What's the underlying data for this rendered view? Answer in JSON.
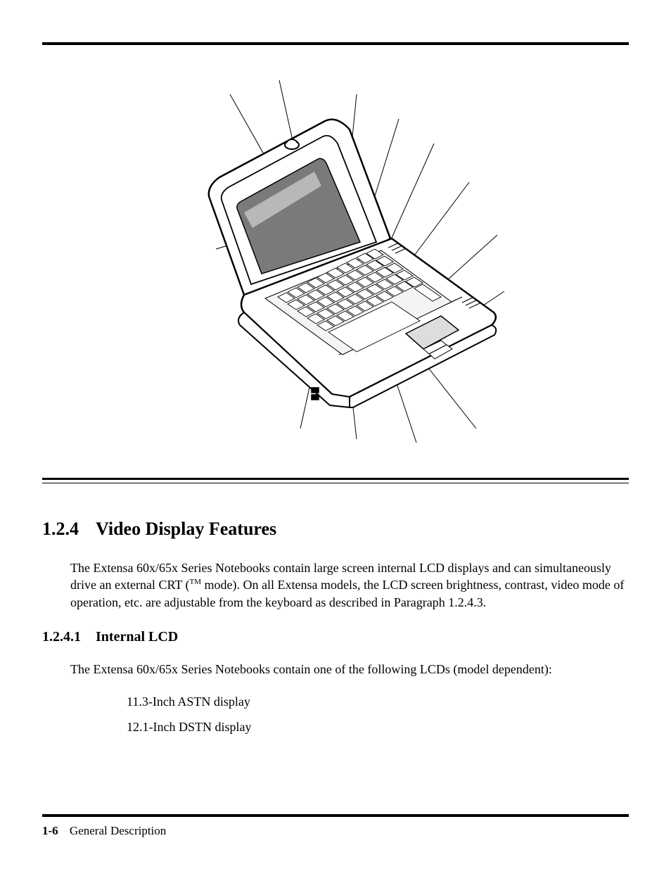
{
  "section": {
    "number": "1.2.4",
    "title": "Video Display Features",
    "paragraph_pre": "The Extensa 60x/65x Series Notebooks contain large screen internal LCD displays and can simultaneously drive an external CRT (",
    "paragraph_tm": "TM",
    "paragraph_post": " mode). On all Extensa models, the LCD screen brightness, contrast, video mode of operation, etc. are adjustable from the keyboard as described in Paragraph 1.2.4.3."
  },
  "subsection": {
    "number": "1.2.4.1",
    "title": "Internal LCD",
    "paragraph": "The Extensa 60x/65x Series Notebooks contain one of the following LCDs (model dependent):",
    "items": [
      "11.3-Inch ASTN display",
      "12.1-Inch DSTN display"
    ]
  },
  "footer": {
    "page_number": "1-6",
    "chapter": "General Description"
  }
}
